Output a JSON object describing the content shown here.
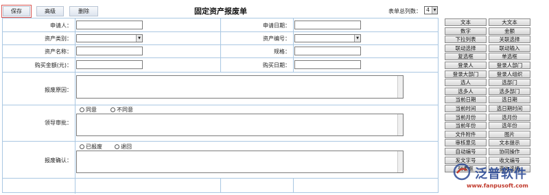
{
  "toolbar": {
    "save_label": "保存",
    "advanced_label": "高级",
    "delete_label": "删除",
    "form_title": "固定资产报废单",
    "columns_label": "表单总列数：",
    "columns_value": "4"
  },
  "form": {
    "applicant_label": "申请人：",
    "apply_date_label": "申请日期：",
    "asset_category_label": "资产类别：",
    "asset_number_label": "资产编号：",
    "asset_name_label": "资产名称：",
    "spec_label": "规格：",
    "purchase_amount_label": "购买金额(元)：",
    "purchase_date_label": "购买日期：",
    "scrap_reason_label": "报废原因：",
    "leader_approval_label": "领导审批：",
    "approve_option": "同意",
    "disapprove_option": "不同意",
    "scrap_confirm_label": "报废确认：",
    "scrapped_option": "已报废",
    "return_option": "退回"
  },
  "palette": [
    "文本",
    "大文本",
    "数字",
    "金额",
    "下拉列表",
    "关联选择",
    "联动选择",
    "联动输入",
    "复选框",
    "单选框",
    "登录人",
    "登录人部门",
    "登录大部门",
    "登录人组织",
    "选人",
    "选部门",
    "选多人",
    "选多部门",
    "当前日期",
    "选日期",
    "当前时间",
    "选日期时间",
    "当前月份",
    "选月份",
    "当前年份",
    "选年份",
    "文件附件",
    "图片",
    "审核意见",
    "文本提示",
    "自动编号",
    "协同操作",
    "发文字号",
    "收文编号",
    "列表框",
    "查询选择"
  ],
  "watermark": {
    "brand": "泛普软件",
    "url": "www.fanpusoft.com",
    "logo_color": "#1f3f8f",
    "accent_color": "#c0392b"
  }
}
